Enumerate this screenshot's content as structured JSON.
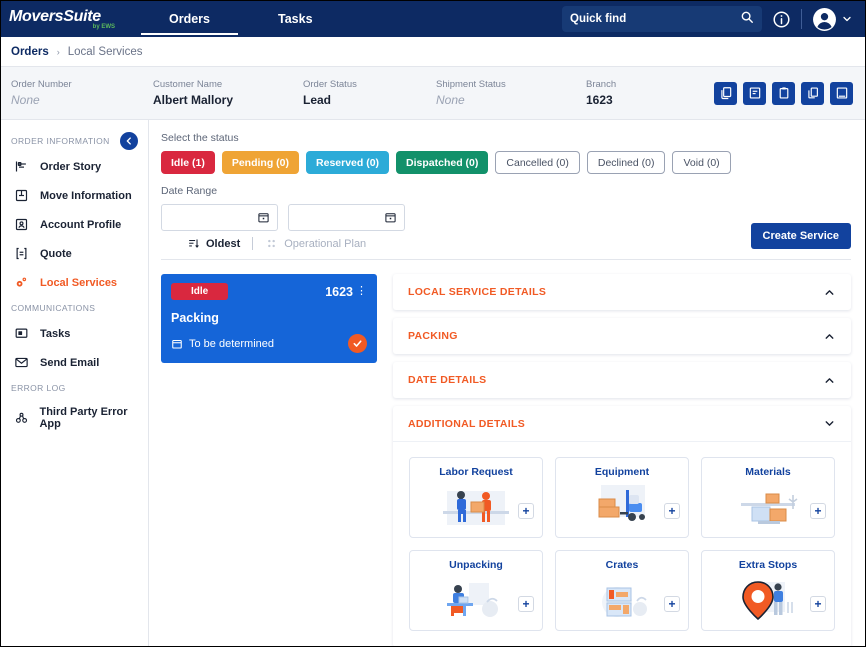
{
  "app": {
    "logo_main": "MoversSuite",
    "logo_sub": "by EWS"
  },
  "nav": {
    "tabs": [
      {
        "label": "Orders",
        "active": true
      },
      {
        "label": "Tasks",
        "active": false
      }
    ],
    "quick_find_placeholder": "Quick find",
    "quick_find_value": "",
    "info_icon": "info-icon",
    "avatar_icon": "user-avatar-icon",
    "chevron_icon": "chevron-down-icon"
  },
  "breadcrumb": {
    "root": "Orders",
    "separator": "›",
    "current": "Local Services"
  },
  "order_bar": {
    "fields": [
      {
        "label": "Order Number",
        "value": "None",
        "is_none": true
      },
      {
        "label": "Customer Name",
        "value": "Albert Mallory",
        "is_none": false
      },
      {
        "label": "Order Status",
        "value": "Lead",
        "is_none": false
      },
      {
        "label": "Shipment Status",
        "value": "None",
        "is_none": true
      },
      {
        "label": "Branch",
        "value": "1623",
        "is_none": false
      }
    ],
    "action_buttons": [
      {
        "name": "copy-document-icon"
      },
      {
        "name": "note-document-icon"
      },
      {
        "name": "clipboard-icon"
      },
      {
        "name": "copy-clipboard-icon"
      },
      {
        "name": "book-icon"
      }
    ]
  },
  "sidebar": {
    "groups": [
      {
        "heading": "ORDER INFORMATION",
        "has_collapse": true,
        "collapse_icon": "chevron-left-icon",
        "items": [
          {
            "label": "Order Story",
            "icon": "order-story-icon",
            "active": false
          },
          {
            "label": "Move Information",
            "icon": "move-information-icon",
            "active": false
          },
          {
            "label": "Account Profile",
            "icon": "account-profile-icon",
            "active": false
          },
          {
            "label": "Quote",
            "icon": "quote-icon",
            "active": false
          },
          {
            "label": "Local Services",
            "icon": "local-services-icon",
            "active": true
          }
        ]
      },
      {
        "heading": "COMMUNICATIONS",
        "has_collapse": false,
        "items": [
          {
            "label": "Tasks",
            "icon": "tasks-icon",
            "active": false
          },
          {
            "label": "Send Email",
            "icon": "envelope-icon",
            "active": false
          }
        ]
      },
      {
        "heading": "ERROR LOG",
        "has_collapse": false,
        "items": [
          {
            "label": "Third Party Error App",
            "icon": "third-party-error-icon",
            "active": false
          }
        ]
      }
    ]
  },
  "main": {
    "status_label": "Select the status",
    "status_chips": [
      {
        "label": "Idle (1)",
        "color": "#d9283f",
        "style": "filled"
      },
      {
        "label": "Pending (0)",
        "color": "#efa435",
        "style": "filled"
      },
      {
        "label": "Reserved (0)",
        "color": "#2cabd8",
        "style": "filled"
      },
      {
        "label": "Dispatched (0)",
        "color": "#12916a",
        "style": "filled"
      },
      {
        "label": "Cancelled (0)",
        "color": "#ffffff",
        "style": "outline"
      },
      {
        "label": "Declined (0)",
        "color": "#ffffff",
        "style": "outline"
      },
      {
        "label": "Void (0)",
        "color": "#ffffff",
        "style": "outline"
      }
    ],
    "date_range_label": "Date Range",
    "date_from_value": "",
    "date_to_value": "",
    "date_placeholder": "",
    "sort_label": "Oldest",
    "sort_icon": "sort-icon",
    "operational_plan_label": "Operational Plan",
    "operational_plan_icon": "grid-dots-icon",
    "create_service_label": "Create Service"
  },
  "service_card": {
    "status_badge": "Idle",
    "number": "1623",
    "kebab_icon": "kebab-menu-icon",
    "title": "Packing",
    "date_icon": "calendar-icon",
    "date_text": "To be determined",
    "check_icon": "check-circle-icon"
  },
  "accordions": [
    {
      "title": "LOCAL SERVICE DETAILS",
      "expanded": false,
      "chevron": "chevron-up-icon"
    },
    {
      "title": "PACKING",
      "expanded": false,
      "chevron": "chevron-up-icon"
    },
    {
      "title": "DATE DETAILS",
      "expanded": false,
      "chevron": "chevron-up-icon"
    },
    {
      "title": "ADDITIONAL DETAILS",
      "expanded": true,
      "chevron": "chevron-down-icon"
    }
  ],
  "tiles": [
    {
      "title": "Labor Request",
      "art": "labor-request-art",
      "add_label": "+"
    },
    {
      "title": "Equipment",
      "art": "equipment-forklift-art",
      "add_label": "+"
    },
    {
      "title": "Materials",
      "art": "materials-boxes-art",
      "add_label": "+"
    },
    {
      "title": "Unpacking",
      "art": "unpacking-art",
      "add_label": "+"
    },
    {
      "title": "Crates",
      "art": "crates-shelf-art",
      "add_label": "+"
    },
    {
      "title": "Extra Stops",
      "art": "extra-stops-pin-art",
      "add_label": "+"
    }
  ],
  "colors": {
    "nav_bg": "#0d2a63",
    "accent_blue": "#12429e",
    "accent_orange": "#f15a24",
    "card_blue": "#1565d8",
    "badge_red": "#d9283f"
  }
}
